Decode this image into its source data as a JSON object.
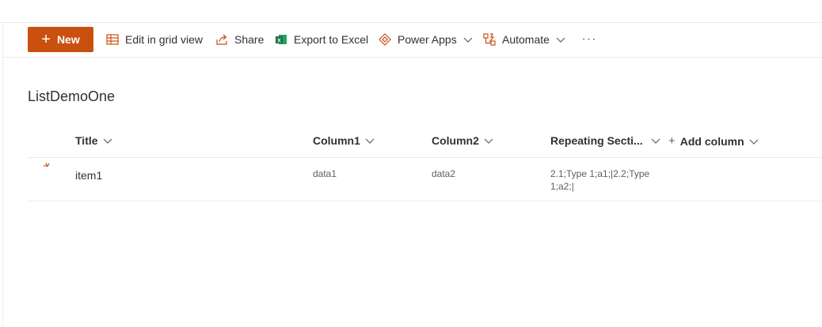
{
  "command_bar": {
    "new_label": "New",
    "edit_grid_label": "Edit in grid view",
    "share_label": "Share",
    "export_label": "Export to Excel",
    "power_apps_label": "Power Apps",
    "automate_label": "Automate",
    "more_label": "···"
  },
  "list": {
    "title": "ListDemoOne",
    "columns": [
      "Title",
      "Column1",
      "Column2",
      "Repeating Secti...",
      "Add column"
    ],
    "rows": [
      {
        "title": "item1",
        "column1": "data1",
        "column2": "data2",
        "repeating_line1": "2.1;Type 1;a1;|2.2;Type",
        "repeating_line2": "1;a2;|"
      }
    ]
  },
  "colors": {
    "accent": "#ca5010",
    "text": "#323130",
    "muted": "#605e5c",
    "divider": "#edebe9",
    "excel_green": "#1e7145"
  }
}
